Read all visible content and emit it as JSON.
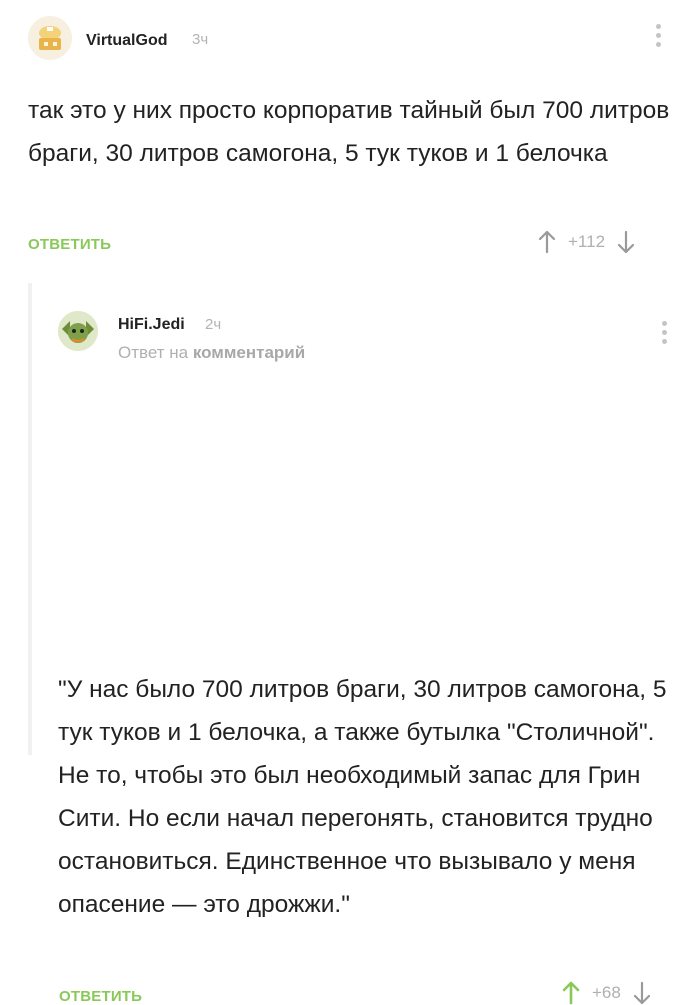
{
  "comments": [
    {
      "username": "VirtualGod",
      "time": "3ч",
      "text": "так это у них просто корпоратив тайный был 700 литров браги, 30 литров самогона, 5 тук туков и 1 белочка",
      "reply_label": "ОТВЕТИТЬ",
      "rating": "+112",
      "upvoted": false
    },
    {
      "username": "HiFi.Jedi",
      "time": "2ч",
      "reply_note_prefix": "Ответ на",
      "reply_note_link": "комментарий",
      "text": "\"У нас было 700 литров браги, 30 литров самогона, 5 тук туков и 1 белочка, а также бутылка \"Столичной\". Не то, чтобы это был необходимый запас для Грин Сити. Но если начал перегонять, становится трудно остановиться. Единственное что вызывало у меня опасение — это дрожжи.\"",
      "reply_label": "ОТВЕТИТЬ",
      "rating": "+68",
      "upvoted": true
    }
  ],
  "colors": {
    "accent": "#8ac858",
    "muted": "#b0b0b0",
    "text": "#222222"
  },
  "icons": {
    "upvote": "arrow-up-icon",
    "downvote": "arrow-down-icon",
    "menu": "more-vertical-icon"
  }
}
